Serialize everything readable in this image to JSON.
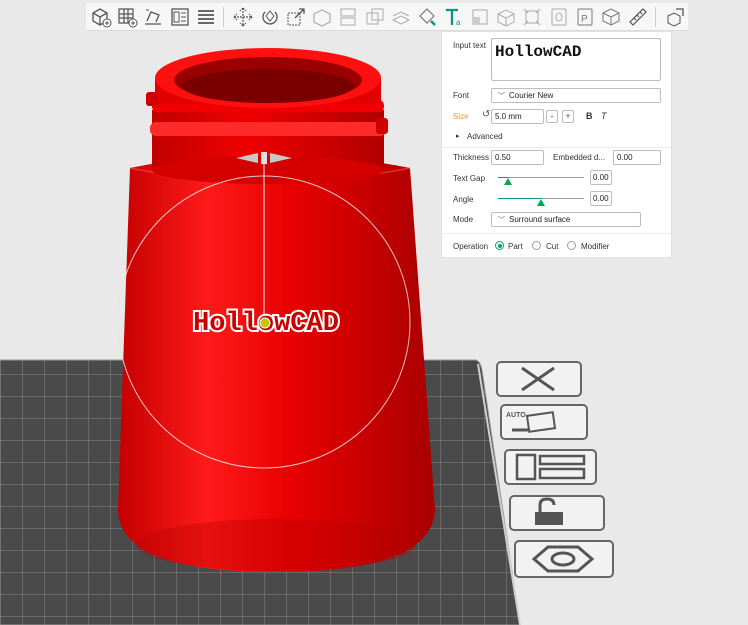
{
  "colors": {
    "accent": "#009688",
    "size_label": "#f7941d",
    "model_red": "#e80000",
    "panel_bg": "#ffffff"
  },
  "toolbar": {
    "tools": [
      "add-cube-icon",
      "grid-arrange-icon",
      "auto-orient-icon",
      "layout-panel-icon",
      "layers-icon",
      "move-icon",
      "rotate-icon",
      "scale-icon",
      "place-on-face-icon",
      "split-icon",
      "boolean-icon",
      "cut-icon",
      "paint-icon",
      "text-tool-icon",
      "support-paint-icon",
      "measure-box-icon",
      "seam-icon",
      "zoom-fit-icon",
      "bed-plate-icon",
      "package-icon",
      "ruler-icon",
      "assembly-icon"
    ]
  },
  "text_panel": {
    "input_text_label": "Input text",
    "input_text_value": "HollowCAD",
    "font_label": "Font",
    "font_value": "Courier New",
    "size_label": "Size",
    "size_value": "5.0 mm",
    "spin_minus": "-",
    "spin_plus": "+",
    "bold_label": "B",
    "italic_label": "T",
    "advanced_label": "Advanced",
    "advanced_arrow": "▸",
    "thickness_label": "Thickness",
    "thickness_value": "0.50",
    "embedded_label": "Embedded d...",
    "embedded_value": "0.00",
    "text_gap_label": "Text Gap",
    "text_gap_value": "0.00",
    "text_gap_level": 0.12,
    "angle_label": "Angle",
    "angle_value": "0.00",
    "angle_level": 0.5,
    "mode_label": "Mode",
    "mode_value": "Surround surface",
    "operation_label": "Operation",
    "operations": [
      "Part",
      "Cut",
      "Modifier"
    ],
    "operation_selected": "Part"
  },
  "scene": {
    "embossed_text": "HollowCAD",
    "side_buttons": [
      "close-icon",
      "auto-arrange-icon",
      "layout-icon",
      "unlock-icon",
      "nut-icon"
    ],
    "side_button_auto_text": "AUTO"
  }
}
